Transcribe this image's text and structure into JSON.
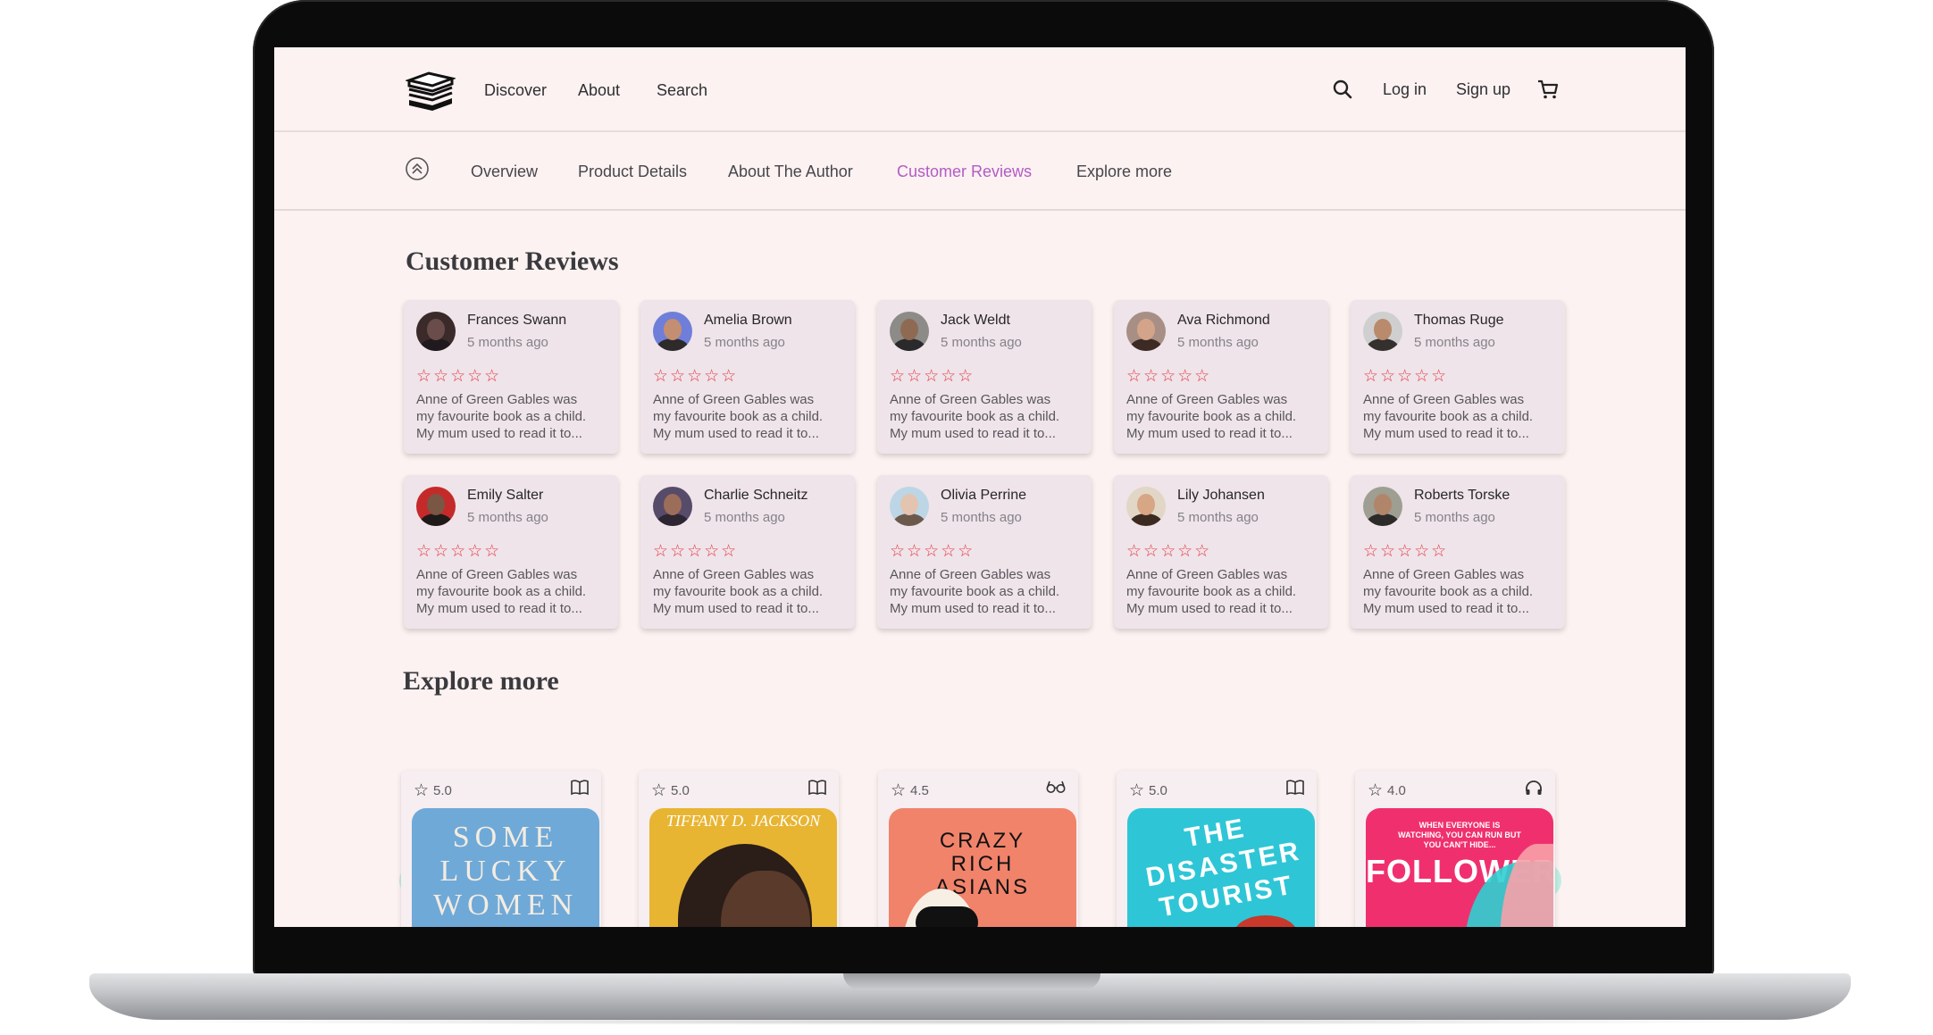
{
  "nav": {
    "links": [
      "Discover",
      "About",
      "Search"
    ],
    "login": "Log in",
    "signup": "Sign up"
  },
  "subnav": {
    "items": [
      "Overview",
      "Product Details",
      "About The Author",
      "Customer Reviews",
      "Explore more"
    ],
    "active": "Customer Reviews"
  },
  "reviews_title": "Customer Reviews",
  "reviews": [
    {
      "name": "Frances Swann",
      "time": "5 months ago",
      "stars": "☆☆☆☆☆",
      "text": "Anne of Green Gables was\nmy favourite book as a child.\nMy mum used to read it to..."
    },
    {
      "name": "Amelia Brown",
      "time": "5 months ago",
      "stars": "☆☆☆☆☆",
      "text": "Anne of Green Gables was\nmy favourite book as a child.\nMy mum used to read it to..."
    },
    {
      "name": "Jack Weldt",
      "time": "5 months ago",
      "stars": "☆☆☆☆☆",
      "text": "Anne of Green Gables was\nmy favourite book as a child.\nMy mum used to read it to..."
    },
    {
      "name": "Ava Richmond",
      "time": "5 months ago",
      "stars": "☆☆☆☆☆",
      "text": "Anne of Green Gables was\nmy favourite book as a child.\nMy mum used to read it to..."
    },
    {
      "name": "Thomas Ruge",
      "time": "5 months ago",
      "stars": "☆☆☆☆☆",
      "text": "Anne of Green Gables was\nmy favourite book as a child.\nMy mum used to read it to..."
    },
    {
      "name": "Emily Salter",
      "time": "5 months ago",
      "stars": "☆☆☆☆☆",
      "text": "Anne of Green Gables was\nmy favourite book as a child.\nMy mum used to read it to..."
    },
    {
      "name": "Charlie Schneitz",
      "time": "5 months ago",
      "stars": "☆☆☆☆☆",
      "text": "Anne of Green Gables was\nmy favourite book as a child.\nMy mum used to read it to..."
    },
    {
      "name": "Olivia Perrine",
      "time": "5 months ago",
      "stars": "☆☆☆☆☆",
      "text": "Anne of Green Gables was\nmy favourite book as a child.\nMy mum used to read it to..."
    },
    {
      "name": "Lily Johansen",
      "time": "5 months ago",
      "stars": "☆☆☆☆☆",
      "text": "Anne of Green Gables was\nmy favourite book as a child.\nMy mum used to read it to..."
    },
    {
      "name": "Roberts Torske",
      "time": "5 months ago",
      "stars": "☆☆☆☆☆",
      "text": "Anne of Green Gables was\nmy favourite book as a child.\nMy mum used to read it to..."
    }
  ],
  "explore_title": "Explore more",
  "books": [
    {
      "rating": "5.0",
      "format_icon": "book-icon",
      "cover_title": "SOME LUCKY WOMEN",
      "cover_color": "#6fa9d8"
    },
    {
      "rating": "5.0",
      "format_icon": "book-icon",
      "cover_title": "TIFFANY D. JACKSON",
      "cover_color": "#e8b533"
    },
    {
      "rating": "4.5",
      "format_icon": "glasses-icon",
      "cover_title": "CRAZY RICH ASIANS",
      "cover_color": "#f1836b"
    },
    {
      "rating": "5.0",
      "format_icon": "book-icon",
      "cover_title": "THE DISASTER TOURIST",
      "cover_color": "#2ec6d6"
    },
    {
      "rating": "4.0",
      "format_icon": "headphones-icon",
      "cover_title": "FOLLOWERS",
      "cover_color": "#f0306e",
      "cover_tagline": "WHEN EVERYONE IS WATCHING, YOU CAN RUN BUT YOU CAN'T HIDE..."
    }
  ],
  "colors": {
    "accent": "#b25bc6",
    "stars": "#e23a48",
    "background": "#fcf2f1",
    "card": "#efe4e9"
  }
}
